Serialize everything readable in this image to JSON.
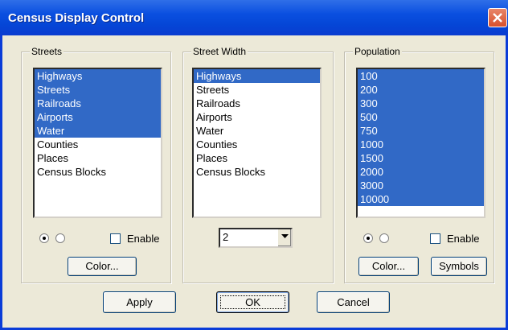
{
  "window": {
    "title": "Census Display Control",
    "titlebar_color": "#0a4fe0",
    "close_icon": "close-icon"
  },
  "streets": {
    "label": "Streets",
    "items": [
      {
        "label": "Highways",
        "selected": true
      },
      {
        "label": "Streets",
        "selected": true
      },
      {
        "label": "Railroads",
        "selected": true
      },
      {
        "label": "Airports",
        "selected": true
      },
      {
        "label": "Water",
        "selected": true
      },
      {
        "label": "Counties",
        "selected": false
      },
      {
        "label": "Places",
        "selected": false
      },
      {
        "label": "Census Blocks",
        "selected": false
      }
    ],
    "radio_selected": 0,
    "enable_label": "Enable",
    "enable_checked": false,
    "color_button": "Color..."
  },
  "street_width": {
    "label": "Street Width",
    "items": [
      {
        "label": "Highways",
        "selected": true
      },
      {
        "label": "Streets",
        "selected": false
      },
      {
        "label": "Railroads",
        "selected": false
      },
      {
        "label": "Airports",
        "selected": false
      },
      {
        "label": "Water",
        "selected": false
      },
      {
        "label": "Counties",
        "selected": false
      },
      {
        "label": "Places",
        "selected": false
      },
      {
        "label": "Census Blocks",
        "selected": false
      }
    ],
    "width_value": "2"
  },
  "population": {
    "label": "Population",
    "items": [
      {
        "label": "100",
        "selected": true
      },
      {
        "label": "200",
        "selected": true
      },
      {
        "label": "300",
        "selected": true
      },
      {
        "label": "500",
        "selected": true
      },
      {
        "label": "750",
        "selected": true
      },
      {
        "label": "1000",
        "selected": true
      },
      {
        "label": "1500",
        "selected": true
      },
      {
        "label": "2000",
        "selected": true
      },
      {
        "label": "3000",
        "selected": true
      },
      {
        "label": "10000",
        "selected": true
      }
    ],
    "radio_selected": 0,
    "enable_label": "Enable",
    "enable_checked": false,
    "color_button": "Color...",
    "symbols_button": "Symbols"
  },
  "footer": {
    "apply": "Apply",
    "ok": "OK",
    "cancel": "Cancel"
  },
  "colors": {
    "selection": "#3169c6",
    "dialog_bg": "#ece9d8"
  }
}
